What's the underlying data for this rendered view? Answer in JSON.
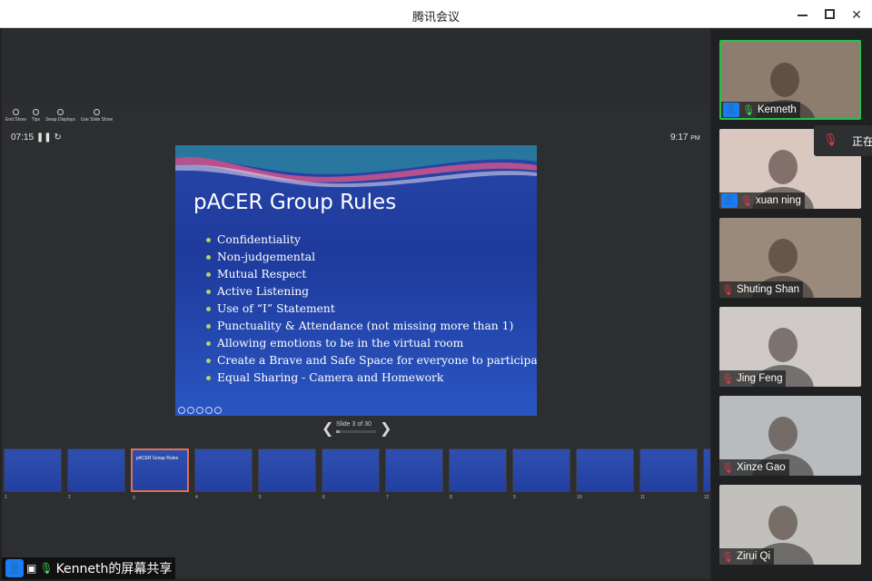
{
  "window": {
    "title": "腾讯会议"
  },
  "presenter_view": {
    "tools": [
      {
        "label": "End Show"
      },
      {
        "label": "Tips"
      },
      {
        "label": "Swap Displays"
      },
      {
        "label": "Use Slide Show"
      }
    ],
    "timer": "07:15",
    "clock": "9:17",
    "clock_ampm": "PM",
    "slide_count": "Slide 3 of 30",
    "current_slide": 3,
    "total_slides": 30
  },
  "slide": {
    "title": "pACER Group Rules",
    "bullets": [
      "Confidentiality",
      "Non-judgemental",
      "Mutual Respect",
      "Active Listening",
      "Use of “I” Statement",
      "Punctuality & Attendance (not missing more than 1)",
      "Allowing emotions to be in the virtual room",
      "Create a Brave and Safe Space for everyone to participate",
      "Equal Sharing - Camera and Homework"
    ]
  },
  "thumbnails": [
    {
      "num": "1",
      "text": ""
    },
    {
      "num": "2",
      "text": ""
    },
    {
      "num": "3",
      "text": "pACER Group Rules"
    },
    {
      "num": "4",
      "text": ""
    },
    {
      "num": "5",
      "text": ""
    },
    {
      "num": "6",
      "text": ""
    },
    {
      "num": "7",
      "text": ""
    },
    {
      "num": "8",
      "text": ""
    },
    {
      "num": "9",
      "text": ""
    },
    {
      "num": "10",
      "text": ""
    },
    {
      "num": "11",
      "text": ""
    },
    {
      "num": "12",
      "text": ""
    }
  ],
  "share_label": "Kenneth的屏幕共享",
  "participants": [
    {
      "name": "Kenneth",
      "host": true,
      "mic": "on",
      "speaking": true
    },
    {
      "name": "xuan ning",
      "host": true,
      "mic": "off",
      "speaking": false
    },
    {
      "name": "Shuting Shan",
      "host": false,
      "mic": "off",
      "speaking": false
    },
    {
      "name": "Jing Feng",
      "host": false,
      "mic": "off",
      "speaking": false
    },
    {
      "name": "Xinze Gao",
      "host": false,
      "mic": "off",
      "speaking": false
    },
    {
      "name": "Zirui Qi",
      "host": false,
      "mic": "off",
      "speaking": false
    }
  ],
  "speaking_popup": {
    "text": "正在"
  },
  "colors": {
    "accent": "#1a7bf2",
    "speaking_border": "#26c14a",
    "mic_off": "#e6394b"
  }
}
